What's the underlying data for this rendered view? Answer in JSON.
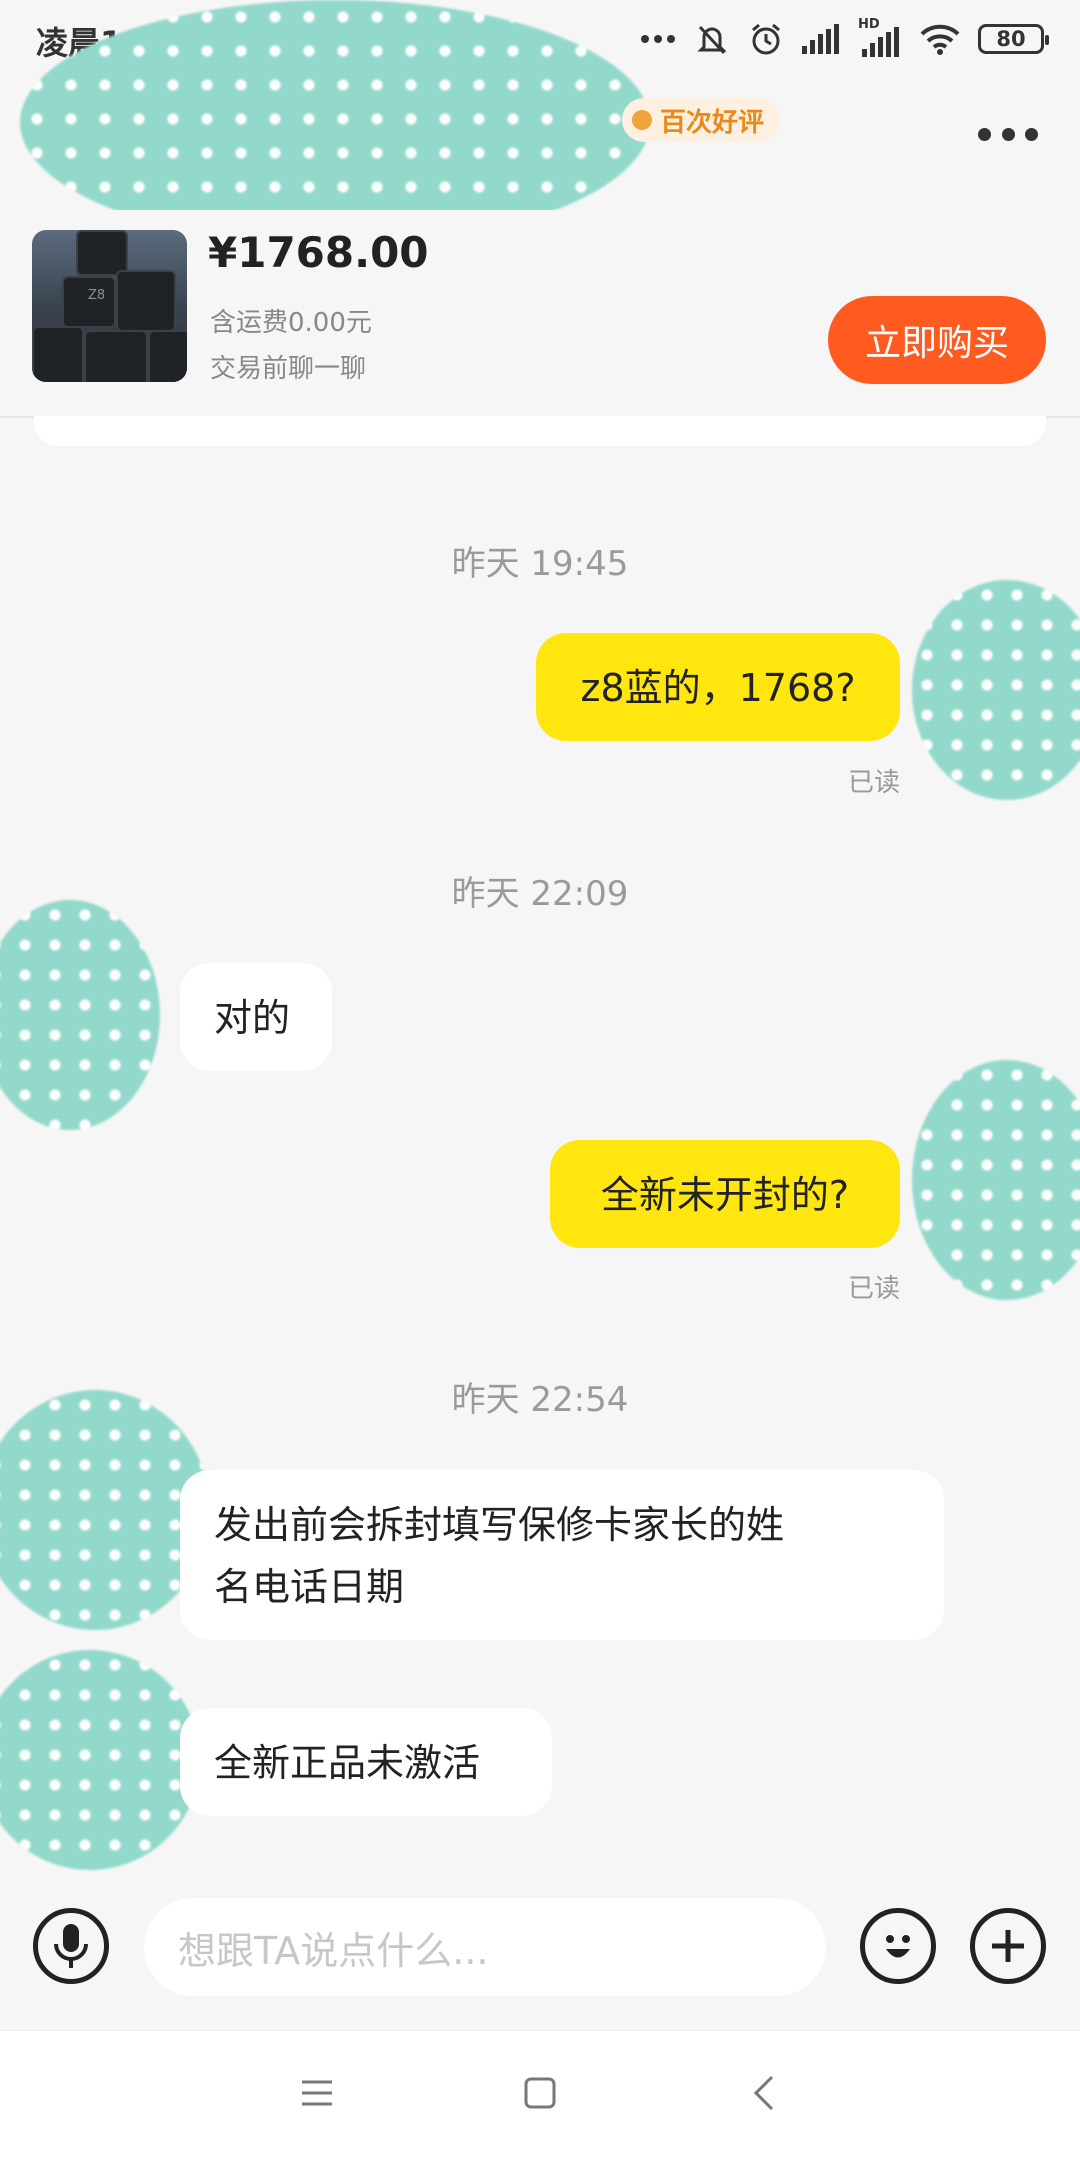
{
  "status_bar": {
    "time": "凌晨1",
    "battery": "80",
    "hd_label": "HD"
  },
  "header": {
    "badge_label": "百次好评"
  },
  "product": {
    "price": "¥1768.00",
    "shipping": "含运费0.00元",
    "chat_hint": "交易前聊一聊",
    "buy_label": "立即购买",
    "thumb_label": "Z8"
  },
  "messages": [
    {
      "timestamp": "昨天 19:45",
      "side": "mine",
      "text": "z8蓝的，1768?",
      "status": "已读"
    },
    {
      "timestamp": "昨天 22:09",
      "side": "theirs",
      "text": "对的"
    },
    {
      "side": "mine",
      "text": "全新未开封的?",
      "status": "已读"
    },
    {
      "timestamp": "昨天 22:54",
      "side": "theirs",
      "text_line1": "发出前会拆封填写保修卡家长的姓",
      "text_line2": "名电话日期"
    },
    {
      "side": "theirs",
      "text": "全新正品未激活"
    }
  ],
  "input_bar": {
    "placeholder": "想跟TA说点什么..."
  },
  "icons": {
    "voice": "microphone-icon",
    "emoji": "emoji-icon",
    "plus": "plus-icon",
    "more": "more-dots-icon",
    "back": "back-arrow-icon"
  },
  "colors": {
    "my_bubble": "#ffe60f",
    "buy_button": "#ff5a1f",
    "badge_text": "#e88a1a"
  }
}
